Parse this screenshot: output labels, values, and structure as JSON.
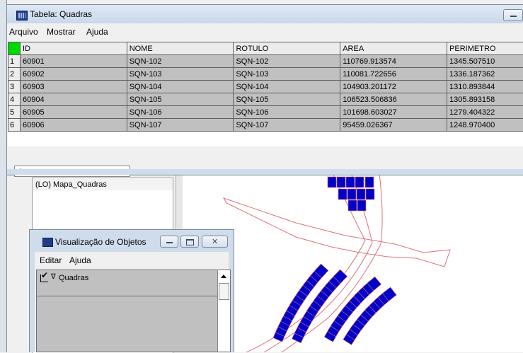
{
  "table_window": {
    "title": "Tabela: Quadras",
    "menu": [
      "Arquivo",
      "Mostrar",
      "Ajuda"
    ],
    "columns": [
      "ID",
      "NOME",
      "ROTULO",
      "AREA",
      "PERIMETRO"
    ],
    "rows": [
      {
        "num": "1",
        "id": "60901",
        "nome": "SQN-102",
        "rotulo": "SQN-102",
        "area": "110769.913574",
        "perimetro": "1345.507510"
      },
      {
        "num": "2",
        "id": "60902",
        "nome": "SQN-103",
        "rotulo": "SQN-103",
        "area": "110081.722656",
        "perimetro": "1336.187362"
      },
      {
        "num": "3",
        "id": "60903",
        "nome": "SQN-104",
        "rotulo": "SQN-104",
        "area": "104903.201172",
        "perimetro": "1310.893844"
      },
      {
        "num": "4",
        "id": "60904",
        "nome": "SQN-105",
        "rotulo": "SQN-105",
        "area": "106523.506836",
        "perimetro": "1305.893158"
      },
      {
        "num": "5",
        "id": "60905",
        "nome": "SQN-106",
        "rotulo": "SQN-106",
        "area": "101698.603027",
        "perimetro": "1279.404322"
      },
      {
        "num": "6",
        "id": "60906",
        "nome": "SQN-107",
        "rotulo": "SQN-107",
        "area": "95459.026367",
        "perimetro": "1248.970400"
      }
    ],
    "corner_color": "#00d800"
  },
  "background": {
    "layer_item": "(LO) Mapa_Quadras",
    "map_fill_color": "#0000c8",
    "map_line_color": "#e0707a"
  },
  "viewer_window": {
    "title": "Visualização de Objetos",
    "menu": [
      "Editar",
      "Ajuda"
    ],
    "item_label": "Quadras",
    "item_checked": true,
    "expand_glyph": "∇"
  }
}
